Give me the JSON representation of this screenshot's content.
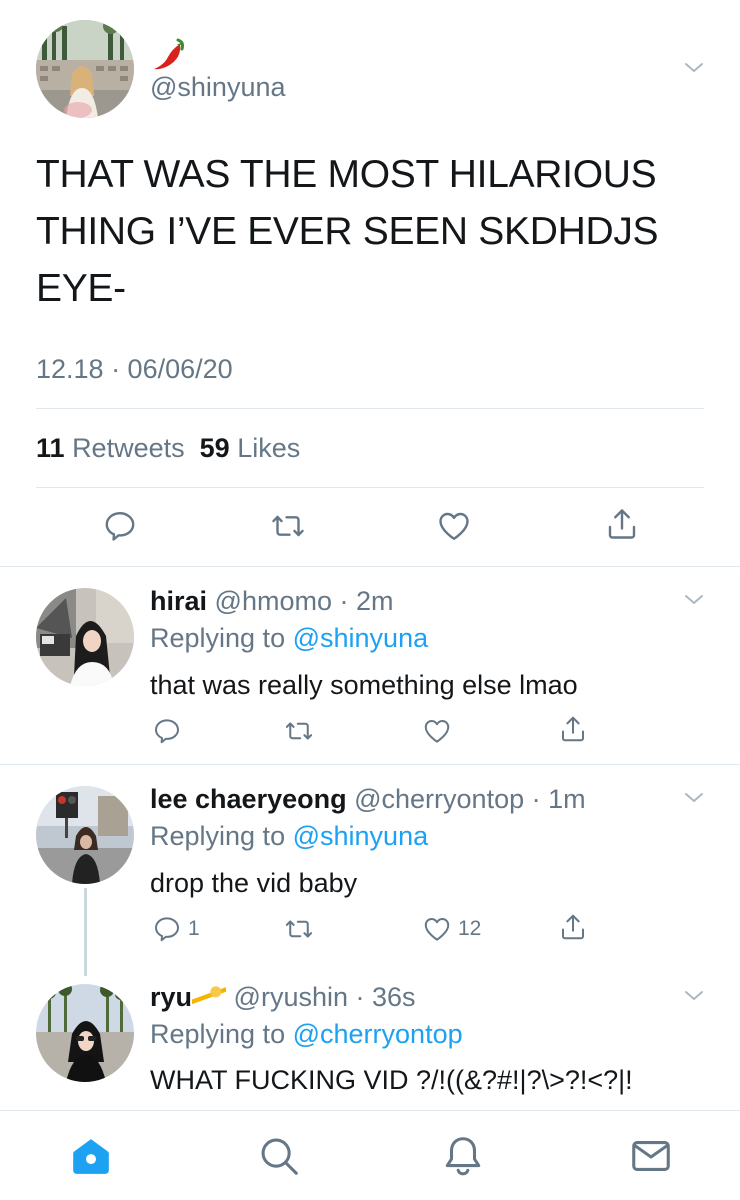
{
  "main_tweet": {
    "emoji": "🌶️",
    "handle": "@shinyuna",
    "text": "THAT WAS THE MOST HILARIOUS THING I’VE EVER SEEN SKDHDJS EYE-",
    "timestamp": "12.18 · 06/06/20",
    "retweets_count": "11",
    "retweets_label": "Retweets",
    "likes_count": "59",
    "likes_label": "Likes"
  },
  "replies": [
    {
      "name": "hirai",
      "handle_time": "@hmomo · 2m",
      "replying_label": "Replying to",
      "replying_to": "@shinyuna",
      "text": "that was really something else lmao",
      "reply_count": "",
      "like_count": ""
    },
    {
      "name": "lee chaeryeong",
      "handle_time": "@cherryontop · 1m",
      "replying_label": "Replying to",
      "replying_to": "@shinyuna",
      "text": "drop the vid baby",
      "reply_count": "1",
      "like_count": "12"
    },
    {
      "name": "ryu",
      "name_emoji": "💫",
      "handle_time": "@ryushin · 36s",
      "replying_label": "Replying to",
      "replying_to": "@cherryontop",
      "text": "WHAT FUCKING VID ?/!((&?#!|?\\>?!<?|!"
    }
  ],
  "icons": {
    "reply": "reply-icon",
    "retweet": "retweet-icon",
    "like": "heart-icon",
    "share": "share-icon",
    "more": "chevron-down-icon",
    "home": "home-icon",
    "search": "search-icon",
    "notifications": "bell-icon",
    "messages": "mail-icon"
  },
  "colors": {
    "accent": "#1da1f2",
    "secondary_text": "#657786",
    "primary_text": "#14171a",
    "divider": "#e1e8ed"
  }
}
